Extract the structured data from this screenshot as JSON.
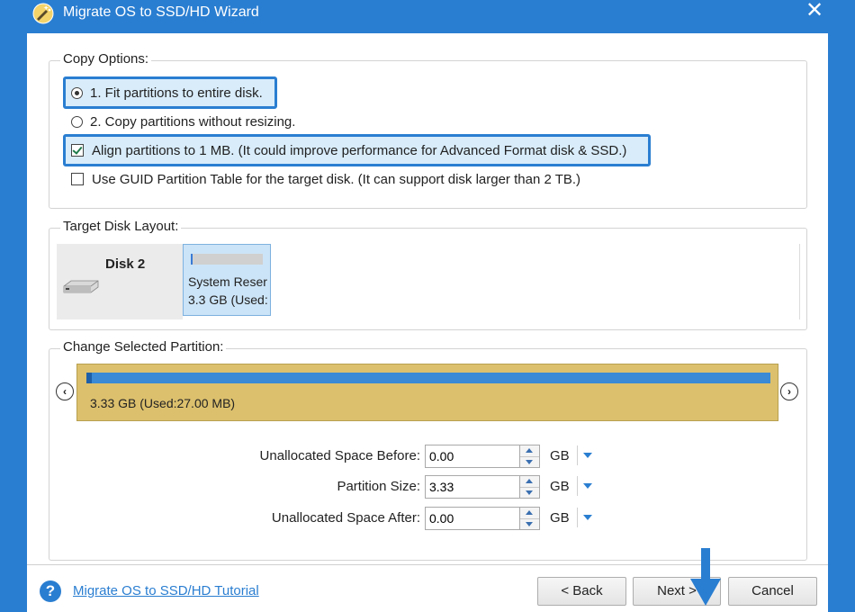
{
  "window": {
    "title": "Migrate OS to SSD/HD Wizard",
    "close_glyph": "✕",
    "app_icon": "wizard-icon"
  },
  "copy_options": {
    "legend": "Copy Options:",
    "options": [
      {
        "label": "1. Fit partitions to entire disk.",
        "type": "radio",
        "checked": true,
        "highlighted": true
      },
      {
        "label": "2. Copy partitions without resizing.",
        "type": "radio",
        "checked": false,
        "highlighted": false
      },
      {
        "label": "Align partitions to 1 MB.  (It could improve performance for Advanced Format disk & SSD.)",
        "type": "checkbox",
        "checked": true,
        "highlighted": true
      },
      {
        "label": "Use GUID Partition Table for the target disk. (It can support disk larger than 2 TB.)",
        "type": "checkbox",
        "checked": false,
        "highlighted": false
      }
    ]
  },
  "target_disk_layout": {
    "legend": "Target Disk Layout:",
    "disk": {
      "name": "Disk 2",
      "icon": "hard-disk-icon"
    },
    "partition": {
      "line1": "System Reser",
      "line2": "3.3 GB (Used:",
      "used_fraction": 0.01
    }
  },
  "change_partition": {
    "legend": "Change Selected Partition:",
    "bar_label": "3.33 GB (Used:27.00 MB)",
    "used_fraction": 0.008,
    "prev_glyph": "‹",
    "next_glyph": "›",
    "fields": [
      {
        "label": "Unallocated Space Before:",
        "value": "0.00",
        "unit": "GB"
      },
      {
        "label": "Partition Size:",
        "value": "3.33",
        "unit": "GB"
      },
      {
        "label": "Unallocated Space After:",
        "value": "0.00",
        "unit": "GB"
      }
    ]
  },
  "footer": {
    "help_glyph": "?",
    "tutorial_link": "Migrate OS to SSD/HD Tutorial",
    "back_label": "< Back",
    "next_label": "Next >",
    "cancel_label": "Cancel"
  },
  "colors": {
    "accent": "#2a7ed1",
    "partition_bar": "#dcc06d",
    "highlight_fill": "#d8ecfa"
  }
}
